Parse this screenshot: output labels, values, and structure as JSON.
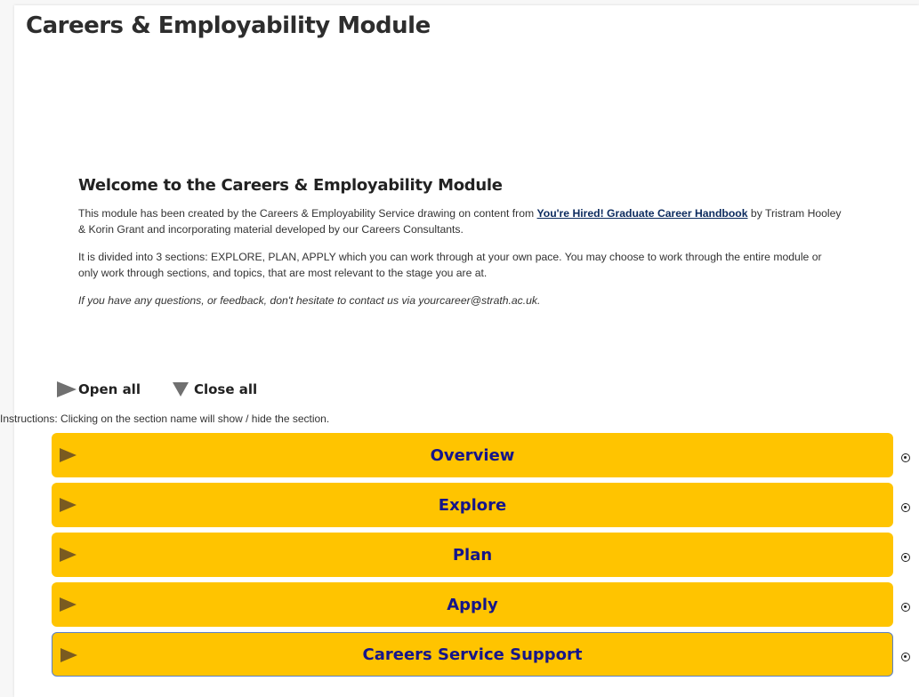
{
  "page": {
    "title": "Careers & Employability Module"
  },
  "welcome": {
    "heading": "Welcome to the Careers & Employability Module",
    "p1_before": "This module has been created by the Careers & Employability Service drawing on content from ",
    "p1_link": "You're Hired! Graduate Career Handbook",
    "p1_after": " by Tristram Hooley & Korin Grant and incorporating material developed by our Careers Consultants.",
    "p2": "It is divided into 3 sections: EXPLORE, PLAN, APPLY which you can work through at your own pace. You may choose to work through the entire module or only work through sections, and topics, that are most relevant to the stage you are at.",
    "p3": "If you have any questions, or feedback, don't hesitate to contact us via yourcareer@strath.ac.uk."
  },
  "controls": {
    "open_all": "Open all",
    "close_all": "Close all",
    "instructions": "Instructions: Clicking on the section name will show / hide the section."
  },
  "sections": [
    {
      "name": "Overview"
    },
    {
      "name": "Explore"
    },
    {
      "name": "Plan"
    },
    {
      "name": "Apply"
    },
    {
      "name": "Careers Service Support"
    }
  ],
  "colors": {
    "section_bar": "#ffc400",
    "section_text": "#15158a",
    "link": "#0b2a5e"
  },
  "icons": {
    "open_all": "triangle-right-icon",
    "close_all": "triangle-down-icon",
    "section_expand": "triangle-right-icon",
    "section_status": "radio-target-icon"
  }
}
